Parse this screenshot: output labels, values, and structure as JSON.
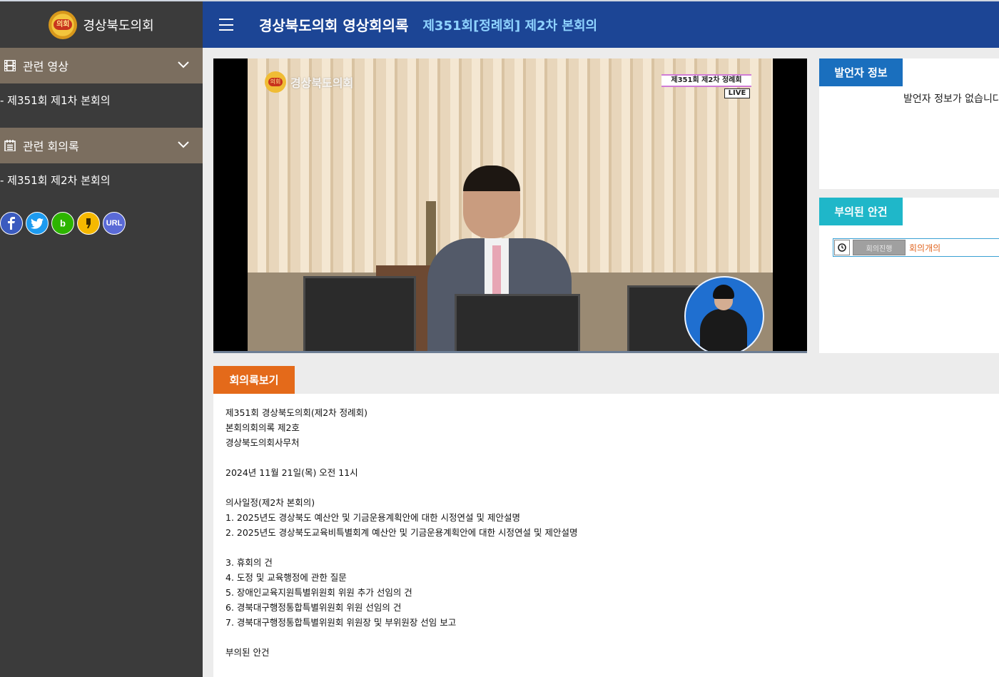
{
  "sidebar": {
    "logo_badge": "의회",
    "logo_text": "경상북도의회",
    "sections": [
      {
        "title": "관련 영상",
        "icon": "film-icon",
        "items": [
          "- 제351회 제1차 본회의"
        ]
      },
      {
        "title": "관련 회의록",
        "icon": "notepad-icon",
        "items": [
          "- 제351회 제2차 본회의"
        ]
      }
    ],
    "share": [
      {
        "name": "facebook",
        "glyph": "f",
        "color": "#3b5bbf"
      },
      {
        "name": "twitter",
        "glyph": "t",
        "color": "#1d9bf0"
      },
      {
        "name": "blog",
        "glyph": "b",
        "color": "#2db400"
      },
      {
        "name": "kakaostory",
        "glyph": "",
        "color": "#f5b800"
      },
      {
        "name": "url",
        "glyph": "URL",
        "color": "#5a6ad6"
      }
    ]
  },
  "header": {
    "title": "경상북도의회 영상회의록",
    "subtitle": "제351회[정례회] 제2차 본회의"
  },
  "video": {
    "logo_text": "경상북도의회",
    "tag_line1": "제351회 제2차 정례회",
    "tag_line2": "LIVE"
  },
  "speaker": {
    "tab": "발언자 정보",
    "message": "발언자 정보가 없습니다"
  },
  "agenda": {
    "tab": "부의된 안건",
    "items": [
      {
        "status": "회의진행",
        "title": "회의개의"
      }
    ]
  },
  "minutes": {
    "tab": "회의록보기",
    "lines": [
      "제351회 경상북도의회(제2차 정례회)",
      "본회의회의록 제2호",
      "경상북도의회사무처",
      "",
      "2024년 11월 21일(목) 오전 11시",
      "",
      "의사일정(제2차 본회의)",
      "1. 2025년도 경상북도 예산안 및 기금운용계획안에 대한 시정연설 및 제안설명",
      "2. 2025년도 경상북도교육비특별회계 예산안 및 기금운용계획안에 대한 시정연설 및 제안설명",
      "",
      "3. 휴회의 건",
      "4. 도정 및 교육행정에 관한 질문",
      "5. 장애인교육지원특별위원회 위원 추가 선임의 건",
      "6. 경북대구행정통합특별위원회 위원 선임의 건",
      "7. 경북대구행정통합특별위원회 위원장 및 부위원장 선임 보고",
      "",
      "부의된 안건"
    ]
  },
  "colors": {
    "sidebar_bg": "#3b3b3b",
    "section_bg": "#7b6e5f",
    "header_bg": "#1c4595",
    "header_sub": "#8fd3ff",
    "speaker_tab": "#1a6fbe",
    "agenda_tab": "#1fb7c9",
    "minutes_tab": "#e46a1a",
    "agenda_title": "#e0621c"
  }
}
